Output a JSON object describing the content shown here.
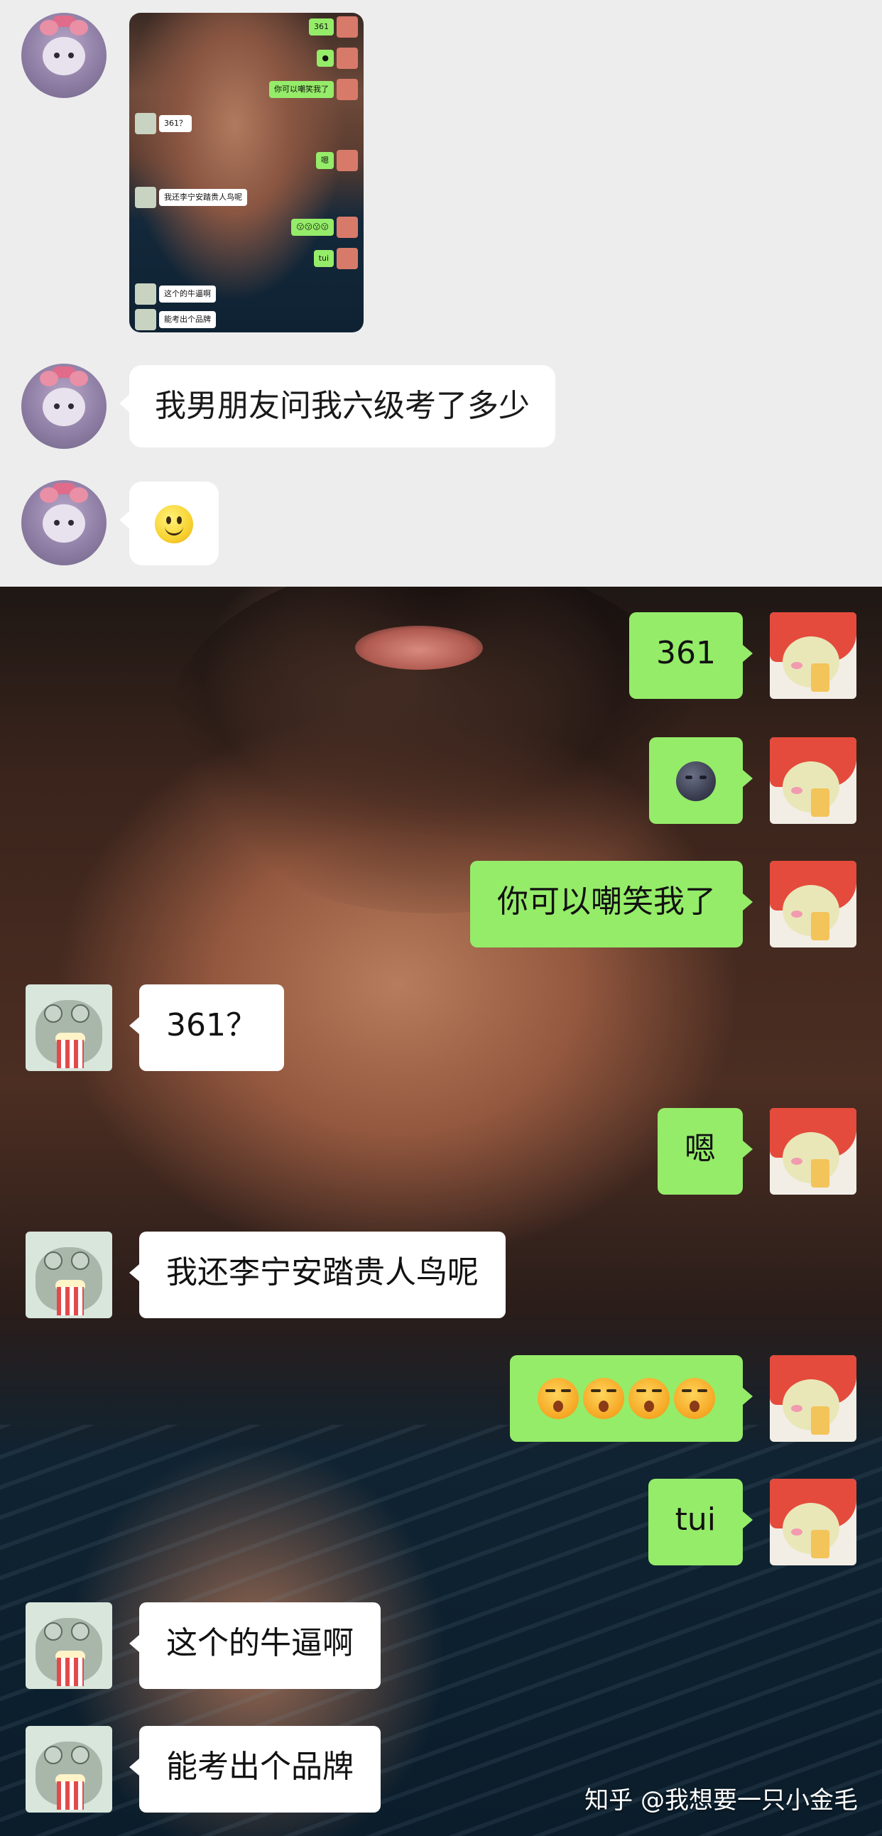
{
  "top_chat": {
    "image_message": {
      "thumb_rows": [
        "361",
        "",
        "你可以嘲笑我了",
        "361？",
        "嗯",
        "我还李宁安踏贵人鸟呢",
        "",
        "tui",
        "这个的牛逼啊",
        "能考出个品牌"
      ]
    },
    "messages": [
      {
        "text": "我男朋友问我六级考了多少"
      },
      {
        "emoji": "slightly-smiling-face"
      }
    ]
  },
  "bottom_chat": {
    "messages": [
      {
        "side": "right",
        "text": "361"
      },
      {
        "side": "right",
        "emoji": "new-moon-face"
      },
      {
        "side": "right",
        "text": "你可以嘲笑我了"
      },
      {
        "side": "left",
        "text": "361？"
      },
      {
        "side": "right",
        "text": "嗯"
      },
      {
        "side": "left",
        "text": "我还李宁安踏贵人鸟呢"
      },
      {
        "side": "right",
        "emoji": "kissing-face x4"
      },
      {
        "side": "right",
        "text": "tui"
      },
      {
        "side": "left",
        "text": "这个的牛逼啊"
      },
      {
        "side": "left",
        "text": "能考出个品牌"
      }
    ]
  },
  "watermark": "知乎 @我想要一只小金毛",
  "colors": {
    "chat_background": "#ededed",
    "green_bubble": "#95ec69",
    "white_bubble": "#ffffff"
  }
}
